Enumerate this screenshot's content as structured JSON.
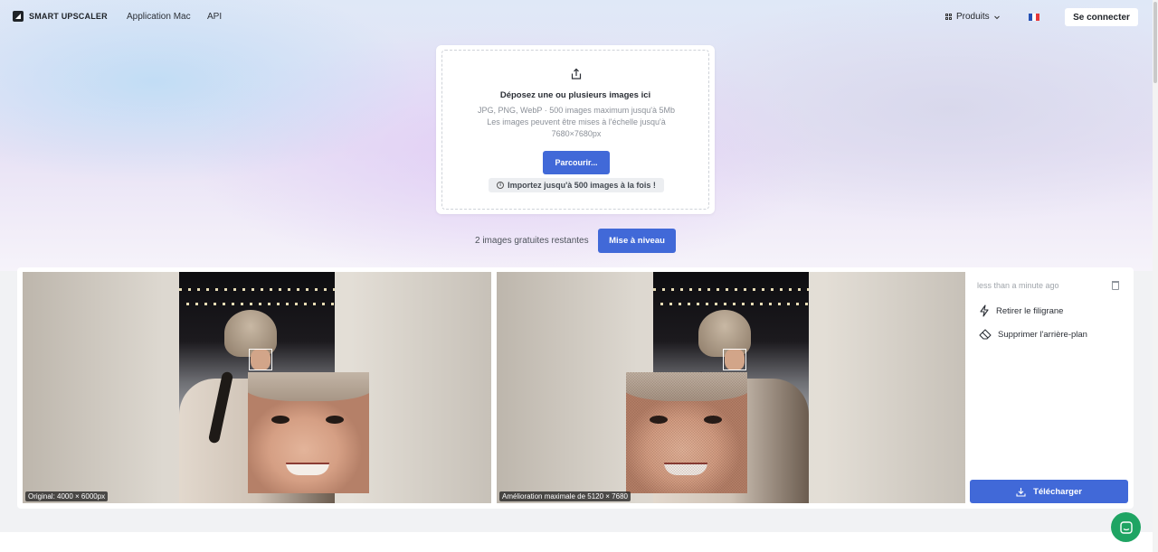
{
  "header": {
    "brand": "SMART UPSCALER",
    "nav": [
      "Application Mac",
      "API"
    ],
    "products_label": "Produits",
    "login_label": "Se connecter",
    "flag_colors": [
      "#2451b5",
      "#ffffff",
      "#e5393b"
    ]
  },
  "upload": {
    "title": "Déposez une ou plusieurs images ici",
    "formats": "JPG, PNG, WebP · 500 images maximum jusqu'à 5Mb",
    "scale_line1": "Les images peuvent être mises à l'échelle jusqu'à",
    "scale_line2": "7680×7680px",
    "browse_label": "Parcourir...",
    "import_note": "Importez jusqu'à 500 images à la fois !"
  },
  "quota": {
    "free_text": "2 images gratuites restantes",
    "upgrade_label": "Mise à niveau"
  },
  "result": {
    "original_caption": "Original: 4000 × 6000px",
    "enhanced_caption": "Amélioration maximale de 5120 × 7680",
    "timestamp": "less than a minute ago",
    "actions": [
      "Retirer le filigrane",
      "Supprimer l'arrière-plan"
    ],
    "download_label": "Télécharger"
  },
  "colors": {
    "accent": "#4169d8",
    "chat": "#1fa463"
  },
  "icons": [
    "upload-icon",
    "grid-icon",
    "chevron-down-icon",
    "info-icon",
    "trash-icon",
    "lightning-icon",
    "eraser-icon",
    "download-icon",
    "chat-icon"
  ]
}
